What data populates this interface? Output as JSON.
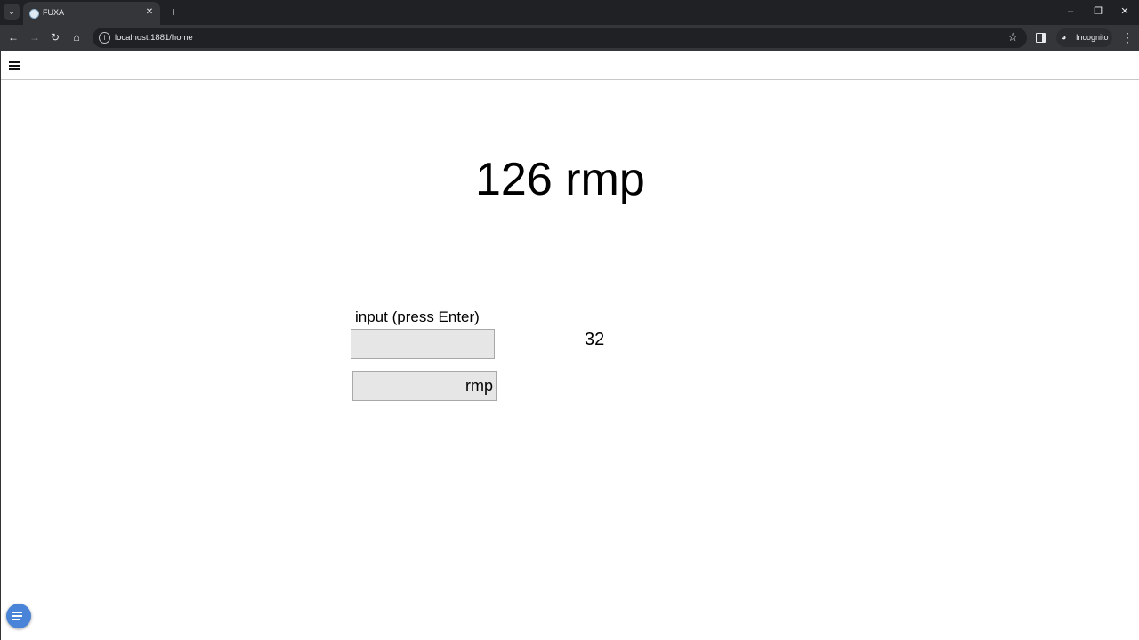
{
  "browser": {
    "tab_title": "FUXA",
    "url": "localhost:1881/home",
    "incognito_label": "Incognito",
    "icons": {
      "tab_list": "chevron-down-icon",
      "tab_close": "close-icon",
      "new_tab": "plus-icon",
      "minimize": "minimize-icon",
      "restore": "restore-icon",
      "close_window": "close-icon",
      "back": "arrow-left-icon",
      "forward": "arrow-right-icon",
      "reload": "reload-icon",
      "home": "home-icon",
      "site_info": "info-icon",
      "bookmark": "star-icon",
      "side_panel": "side-panel-icon",
      "incognito": "incognito-icon",
      "menu": "more-vert-icon"
    }
  },
  "app": {
    "menu_icon": "hamburger-icon",
    "display_value": "126 rmp",
    "input_label": "input (press Enter)",
    "input_value": "",
    "unit_field_text": "rmp",
    "side_value": "32",
    "fab_icon": "menu-icon",
    "colors": {
      "fab": "#4a84d8",
      "field_background": "#e6e6e6"
    }
  }
}
